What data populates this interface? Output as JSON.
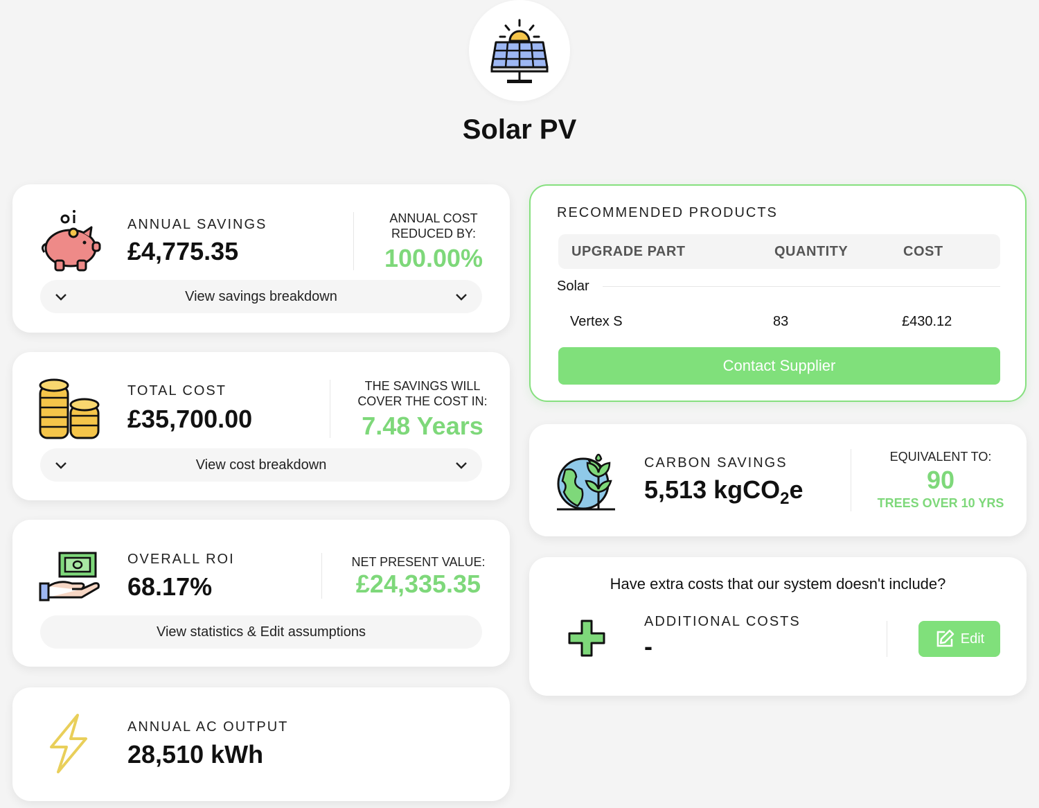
{
  "page": {
    "title": "Solar PV",
    "header_icon": "solar-panel-icon"
  },
  "annual_savings": {
    "icon": "piggy-bank-icon",
    "label": "ANNUAL SAVINGS",
    "value": "£4,775.35",
    "side_label": "ANNUAL COST REDUCED BY:",
    "side_value": "100.00%",
    "toggle_label": "View savings breakdown"
  },
  "total_cost": {
    "icon": "coins-stack-icon",
    "label": "TOTAL COST",
    "value": "£35,700.00",
    "side_label": "THE SAVINGS WILL COVER THE COST IN:",
    "side_value": "7.48 Years",
    "toggle_label": "View cost breakdown"
  },
  "overall_roi": {
    "icon": "cash-in-hand-icon",
    "label": "OVERALL ROI",
    "value": "68.17%",
    "side_label": "NET PRESENT VALUE:",
    "side_value": "£24,335.35",
    "toggle_label": "View statistics & Edit assumptions"
  },
  "ac_output": {
    "icon": "lightning-bolt-icon",
    "label": "ANNUAL AC OUTPUT",
    "value": "28,510 kWh"
  },
  "recommended": {
    "title": "RECOMMENDED PRODUCTS",
    "columns": [
      "UPGRADE PART",
      "QUANTITY",
      "COST"
    ],
    "group": "Solar",
    "rows": [
      {
        "part": "Vertex S",
        "quantity": "83",
        "cost": "£430.12"
      }
    ],
    "button_label": "Contact Supplier"
  },
  "carbon": {
    "icon": "earth-plant-icon",
    "label": "CARBON SAVINGS",
    "value_main": "5,513 kgCO",
    "value_sub": "2",
    "value_end": "e",
    "side_label": "EQUIVALENT TO:",
    "side_value": "90",
    "side_caption": "TREES OVER 10 YRS"
  },
  "extra_costs": {
    "question": "Have extra costs that our system doesn't include?",
    "icon": "plus-icon",
    "label": "ADDITIONAL COSTS",
    "value": "-",
    "edit_label": "Edit",
    "edit_icon": "edit-pencil-icon"
  },
  "colors": {
    "accent": "#80e07b",
    "accent_text": "#7ed87a",
    "background": "#f4f4f4"
  }
}
